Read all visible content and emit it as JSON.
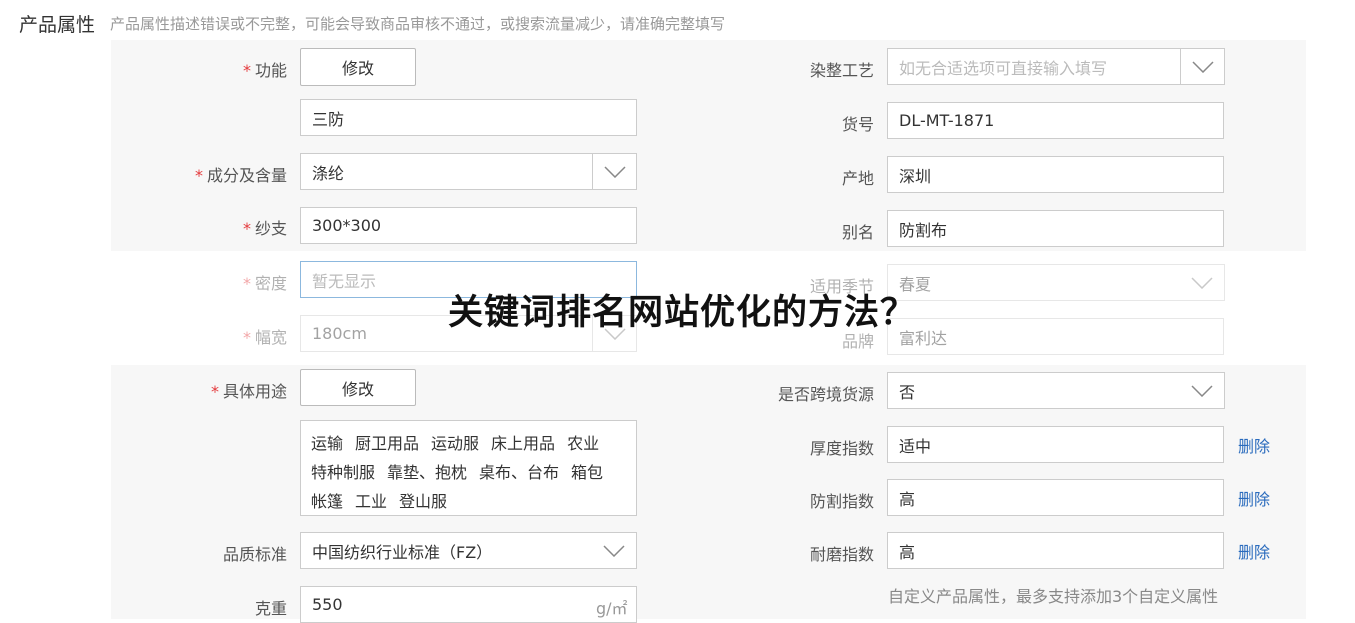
{
  "section": {
    "title": "产品属性",
    "hint": "产品属性描述错误或不完整，可能会导致商品审核不通过，或搜索流量减少，请准确完整填写"
  },
  "left": {
    "function": {
      "label": "功能",
      "button": "修改",
      "value": "三防"
    },
    "composition": {
      "label": "成分及含量",
      "value": "涤纶"
    },
    "yarn": {
      "label": "纱支",
      "value": "300*300"
    },
    "density": {
      "label": "密度",
      "placeholder": "暂无显示"
    },
    "width": {
      "label": "幅宽",
      "value": "180cm"
    },
    "usage": {
      "label": "具体用途",
      "button": "修改",
      "tags": [
        "运输",
        "厨卫用品",
        "运动服",
        "床上用品",
        "农业",
        "特种制服",
        "靠垫、抱枕",
        "桌布、台布",
        "箱包",
        "帐篷",
        "工业",
        "登山服"
      ]
    },
    "quality": {
      "label": "品质标准",
      "value": "中国纺织行业标准（FZ）"
    },
    "weight": {
      "label": "克重",
      "value": "550",
      "unit": "g/㎡"
    }
  },
  "right": {
    "dyeing": {
      "label": "染整工艺",
      "placeholder": "如无合适选项可直接输入填写"
    },
    "sku": {
      "label": "货号",
      "value": "DL-MT-1871"
    },
    "origin": {
      "label": "产地",
      "value": "深圳"
    },
    "alias": {
      "label": "别名",
      "value": "防割布"
    },
    "season": {
      "label": "适用季节",
      "value": "春夏"
    },
    "brand": {
      "label": "品牌",
      "value": "富利达"
    },
    "crossborder": {
      "label": "是否跨境货源",
      "value": "否"
    },
    "custom": [
      {
        "label": "厚度指数",
        "value": "适中",
        "action": "删除"
      },
      {
        "label": "防割指数",
        "value": "高",
        "action": "删除"
      },
      {
        "label": "耐磨指数",
        "value": "高",
        "action": "删除"
      }
    ],
    "custom_hint": "自定义产品属性，最多支持添加3个自定义属性"
  },
  "overlay_title": "关键词排名网站优化的方法？",
  "icons": {
    "dropdown": "chevron-down-icon"
  },
  "colors": {
    "required": "#e4393c",
    "link": "#2a6bbd",
    "panel": "#f7f7f7"
  }
}
